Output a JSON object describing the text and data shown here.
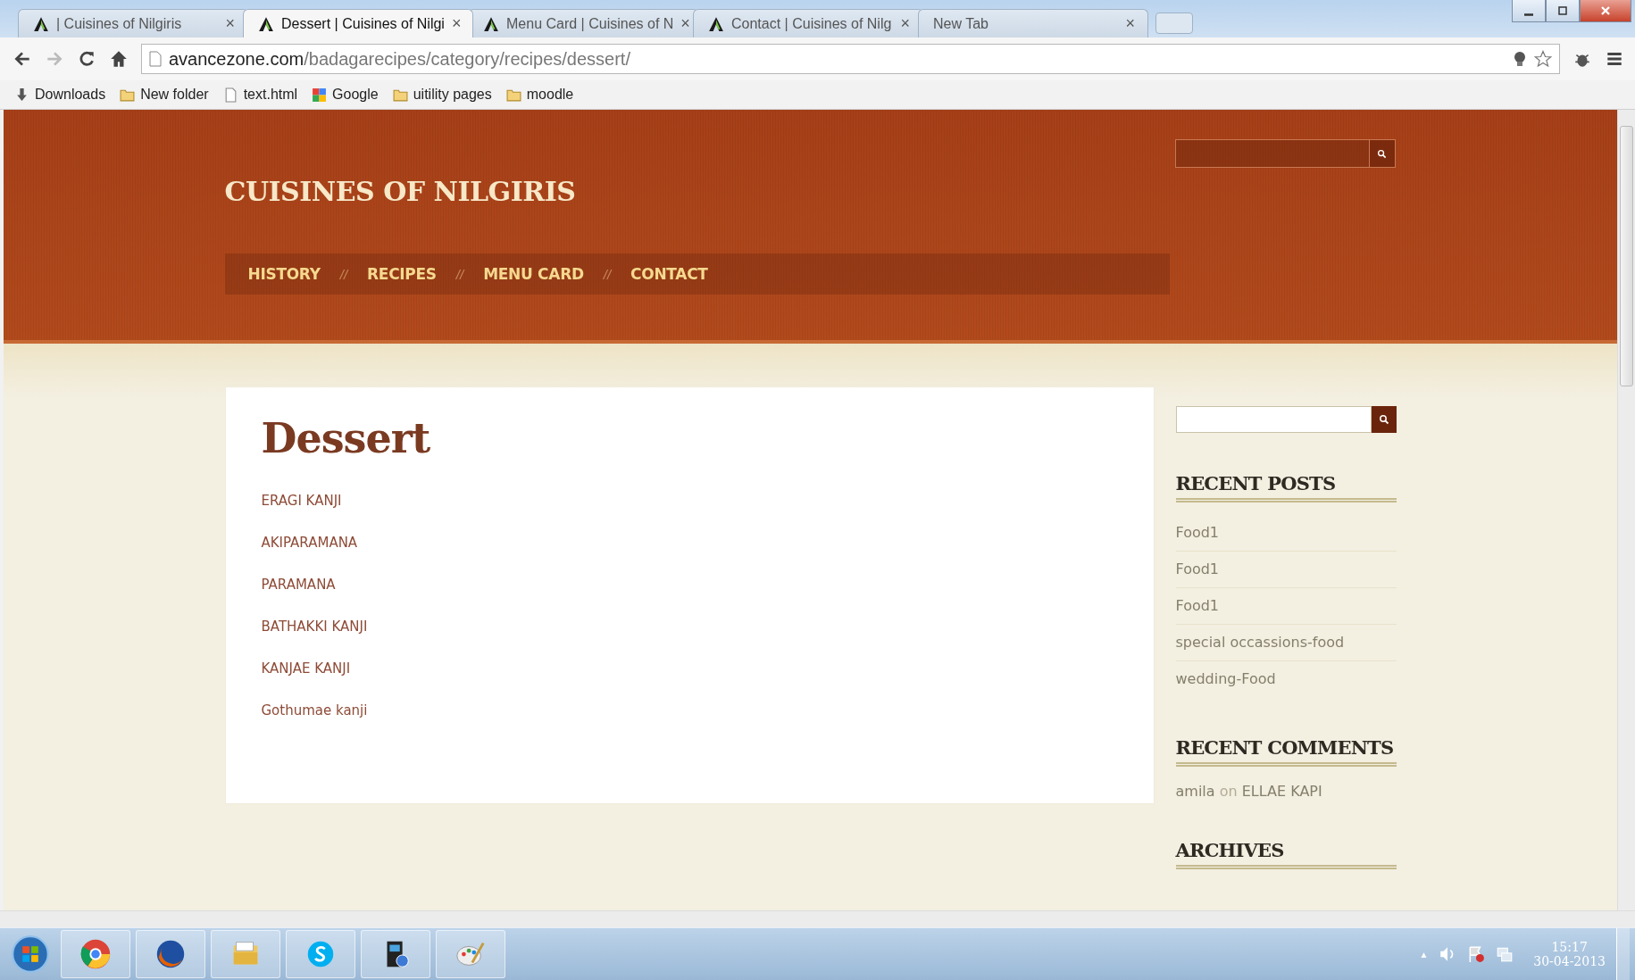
{
  "browser": {
    "tabs": [
      {
        "title": "| Cuisines of Nilgiris",
        "selected": false
      },
      {
        "title": "Dessert | Cuisines of Nilgi",
        "selected": true
      },
      {
        "title": "Menu Card | Cuisines of N",
        "selected": false
      },
      {
        "title": "Contact | Cuisines of Nilg",
        "selected": false
      },
      {
        "title": "New Tab",
        "selected": false,
        "kind": "blank"
      }
    ],
    "close_glyph": "×",
    "url": {
      "host": "avancezone.com",
      "path": "/badagarecipes/category/recipes/dessert/"
    },
    "bookmarks": [
      {
        "label": "Downloads",
        "kind": "download"
      },
      {
        "label": "New folder",
        "kind": "folder"
      },
      {
        "label": "text.html",
        "kind": "page"
      },
      {
        "label": "Google",
        "kind": "google"
      },
      {
        "label": "uitility pages",
        "kind": "folder"
      },
      {
        "label": "moodle",
        "kind": "folder"
      }
    ]
  },
  "site": {
    "title": "CUISINES OF NILGIRIS",
    "nav": [
      {
        "label": "HISTORY"
      },
      {
        "label": "RECIPES"
      },
      {
        "label": "MENU CARD"
      },
      {
        "label": "CONTACT"
      }
    ],
    "nav_separator": "//"
  },
  "content": {
    "heading": "Dessert",
    "posts": [
      "ERAGI KANJI",
      "AKIPARAMANA",
      "PARAMANA",
      "BATHAKKI KANJI",
      "KANJAE KANJI",
      "Gothumae kanji"
    ]
  },
  "sidebar": {
    "recent_posts": {
      "title": "RECENT POSTS",
      "items": [
        "Food1",
        "Food1",
        "Food1",
        "special occassions-food",
        "wedding-Food"
      ]
    },
    "recent_comments": {
      "title": "RECENT COMMENTS",
      "items": [
        {
          "author": "amila",
          "joiner": "on",
          "post": "ELLAE KAPI"
        }
      ]
    },
    "archives": {
      "title": "ARCHIVES"
    }
  },
  "taskbar": {
    "apps": [
      {
        "kind": "chrome"
      },
      {
        "kind": "firefox"
      },
      {
        "kind": "files"
      },
      {
        "kind": "skype"
      },
      {
        "kind": "setup"
      },
      {
        "kind": "paint"
      }
    ],
    "tray_arrow": "▲",
    "time": "15:17",
    "date": "30-04-2013"
  }
}
